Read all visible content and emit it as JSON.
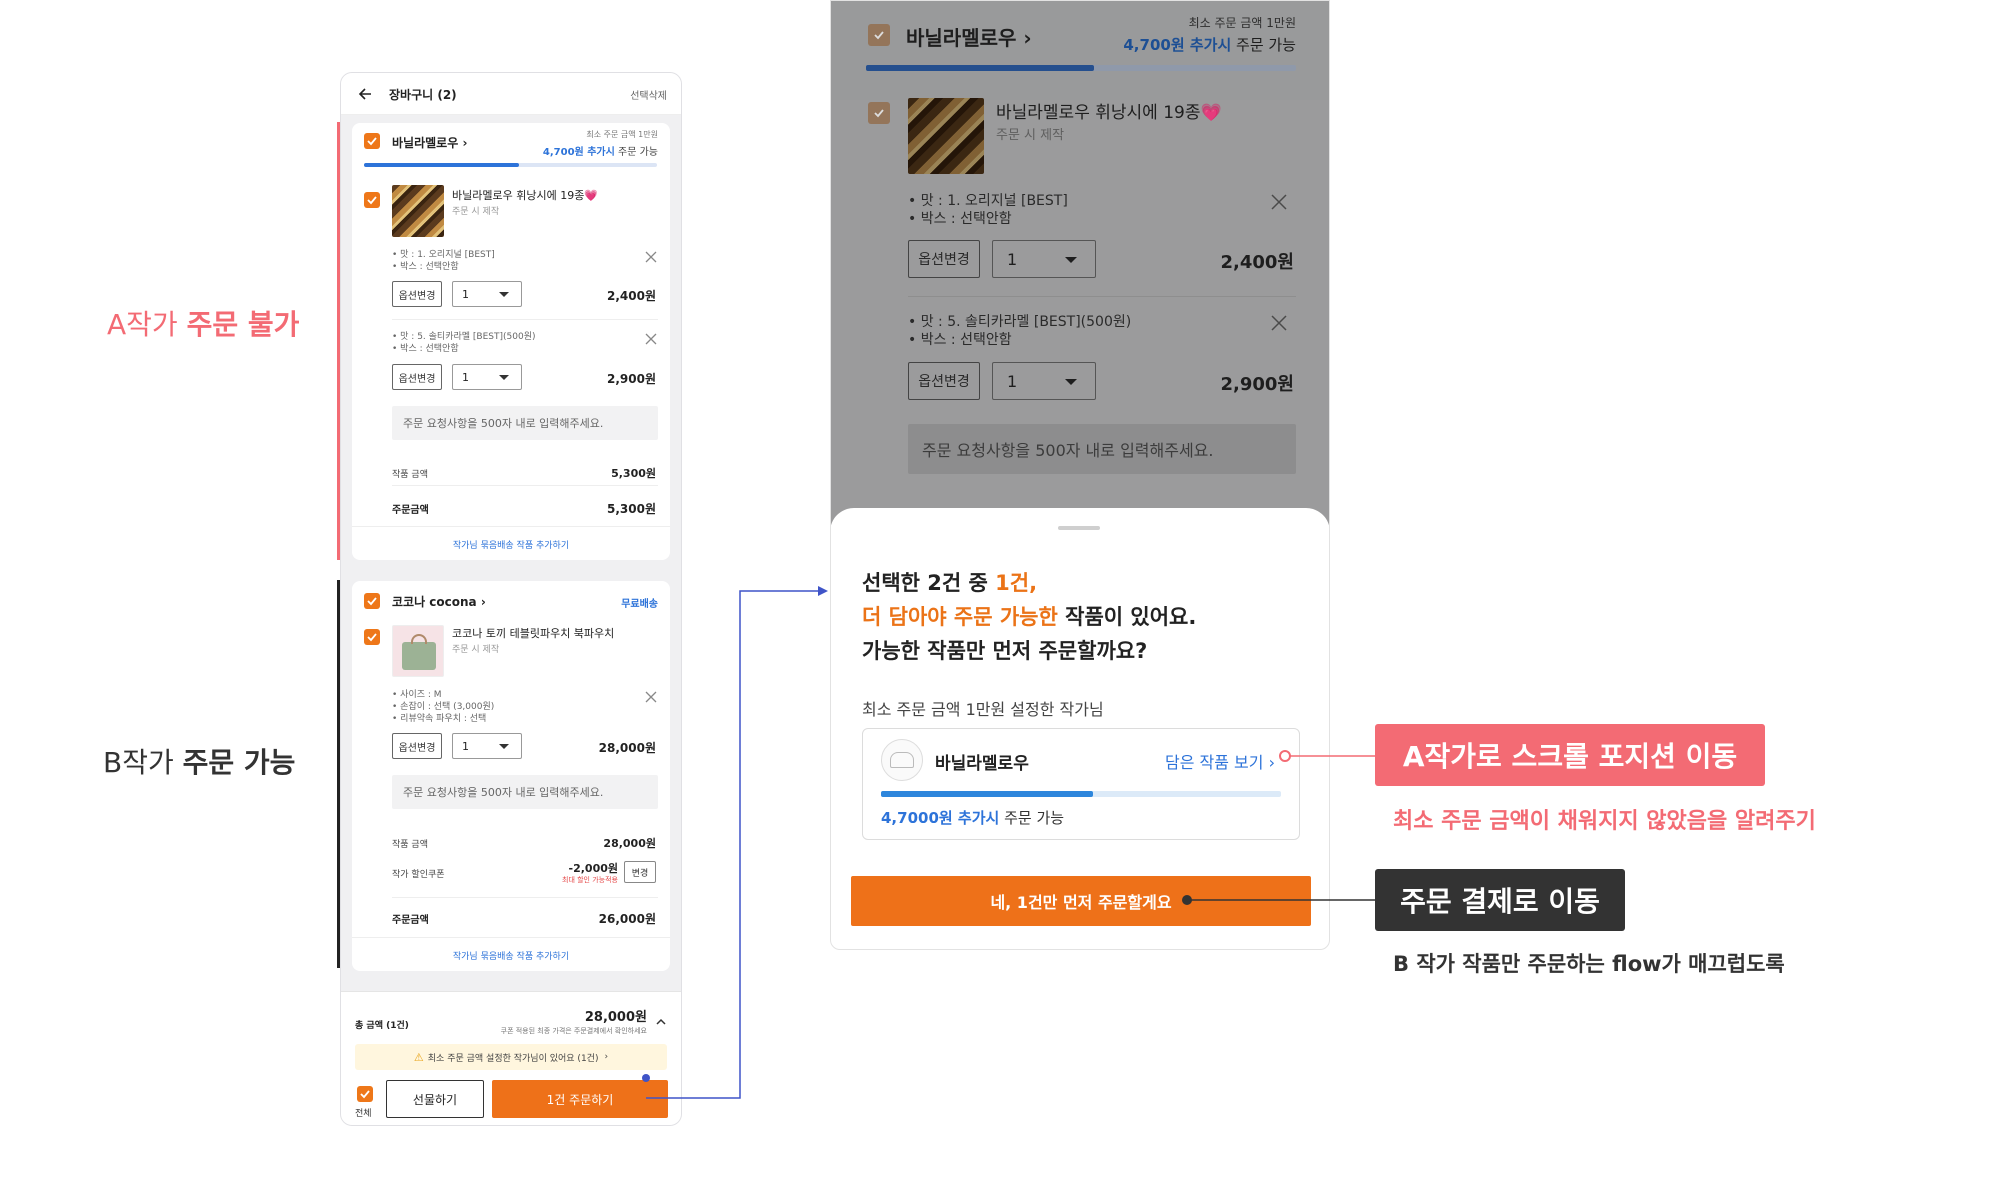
{
  "colors": {
    "accent": "#EE7719",
    "blue": "#2D73D9",
    "red_annot": "#F36B74",
    "dark_annot": "#333333"
  },
  "annotations": {
    "a_prefix": "A작가 ",
    "a_strong": "주문 불가",
    "b_prefix": "B작가 ",
    "b_strong": "주문 가능",
    "scroll_label": "A작가로 스크롤 포지션 이동",
    "scroll_desc": "최소 주문 금액이 채워지지 않았음을 알려주기",
    "checkout_label": "주문 결제로 이동",
    "checkout_desc": "B 작가 작품만 주문하는 flow가 매끄럽도록"
  },
  "cart": {
    "back_icon": "arrow-left-icon",
    "title": "장바구니 (2)",
    "delete_selected": "선택삭제",
    "sellerA": {
      "name": "바닐라멜로우",
      "min_order": "최소 주문 금액 1만원",
      "add_amount": "4,700원 추가시",
      "add_suffix": " 주문 가능",
      "progress": 0.53,
      "item": {
        "title": "바닐라멜로우 휘낭시에 19종💗",
        "made": "주문 시 제작",
        "opt1": [
          "• 맛 : 1. 오리지널 [BEST]",
          "• 박스 : 선택안함"
        ],
        "opt1_qty": "1",
        "opt1_price": "2,400원",
        "opt2": [
          "• 맛 : 5. 솔티카라멜 [BEST](500원)",
          "• 박스 : 선택안함"
        ],
        "opt2_qty": "1",
        "opt2_price": "2,900원",
        "option_change": "옵션변경"
      },
      "memo_placeholder": "주문 요청사항을 500자 내로 입력해주세요.",
      "item_amount_label": "작품 금액",
      "item_amount": "5,300원",
      "order_amount_label": "주문금액",
      "order_amount": "5,300원",
      "bundle_link": "작가님 묶음배송 작품 추가하기"
    },
    "sellerB": {
      "name": "코코나 cocona",
      "free_ship": "무료배송",
      "item": {
        "title": "코코나 토끼 테블릿파우치 북파우치",
        "made": "주문 시 제작",
        "opts": [
          "• 사이즈 : M",
          "• 손잡이 : 선택 (3,000원)",
          "• 리뷰약속 파우치 : 선택"
        ],
        "qty": "1",
        "price": "28,000원",
        "option_change": "옵션변경"
      },
      "memo_placeholder": "주문 요청사항을 500자 내로 입력해주세요.",
      "item_amount_label": "작품 금액",
      "item_amount": "28,000원",
      "coupon_label": "작가 할인쿠폰",
      "coupon_amount": "-2,000원",
      "coupon_note": "최대 할인 가능적용",
      "coupon_btn": "변경",
      "order_amount_label": "주문금액",
      "order_amount": "26,000원",
      "bundle_link": "작가님 묶음배송 작품 추가하기"
    },
    "total_label": "총 금액 (1건)",
    "total_amount": "28,000원",
    "total_note": "쿠폰 적용된 최종 가격은 주문결제에서 확인하세요",
    "warning": "최소 주문 금액 설정한 작가님이 있어요 (1건)",
    "select_all": "전체",
    "gift_btn": "선물하기",
    "order_btn": "1건 주문하기"
  },
  "modal": {
    "bg_seller": "바닐라멜로우",
    "bg_min": "최소 주문 금액 1만원",
    "bg_add": "4,700원 추가시",
    "bg_add_suffix": " 주문 가능",
    "bg_item_title": "바닐라멜로우 휘낭시에 19종💗",
    "bg_made": "주문 시 제작",
    "bg_opt1": [
      "• 맛 : 1. 오리지널 [BEST]",
      "• 박스 : 선택안함"
    ],
    "bg_price1": "2,400원",
    "bg_opt2": [
      "• 맛 : 5. 솔티카라멜 [BEST](500원)",
      "• 박스 : 선택안함"
    ],
    "bg_price2": "2,900원",
    "bg_qty": "1",
    "bg_option_change": "옵션변경",
    "bg_memo": "주문 요청사항을 500자 내로 입력해주세요.",
    "line1_a": "선택한 2건 중 ",
    "line1_b": "1건,",
    "line2_a": "더 담아야 주문 가능한",
    "line2_b": " 작품이 있어요.",
    "line3": "가능한 작품만 먼저 주문할까요?",
    "subhead": "최소 주문 금액 1만원 설정한 작가님",
    "seller_name": "바닐라멜로우",
    "view_items": "담은 작품 보기",
    "progress": 0.53,
    "add_amount": "4,7000원 추가시",
    "add_suffix": " 주문 가능",
    "confirm_btn": "네, 1건만 먼저 주문할게요"
  }
}
